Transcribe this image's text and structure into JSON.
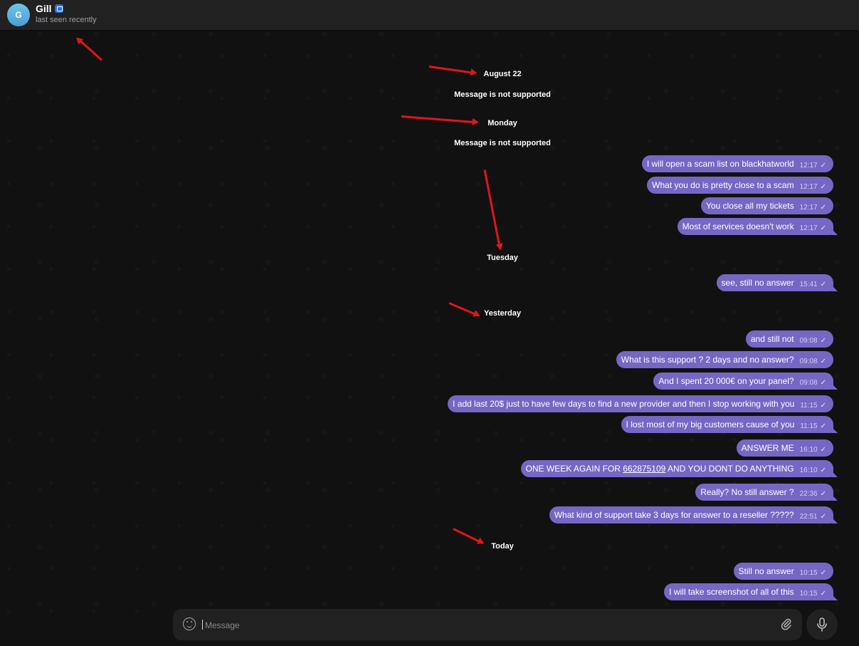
{
  "header": {
    "avatar_letter": "G",
    "name": "Gill",
    "status": "last seen recently"
  },
  "chat": {
    "dates": {
      "d1": "August 22",
      "d2": "Monday",
      "d3": "Tuesday",
      "d4": "Yesterday",
      "d5": "Today"
    },
    "service": {
      "s1": "Message is not supported",
      "s2": "Message is not supported"
    },
    "messages": [
      {
        "text": "I will open a scam list on blackhatworld",
        "time": "12:17"
      },
      {
        "text": "What you do is pretty close to a scam",
        "time": "12:17"
      },
      {
        "text": "You close all my tickets",
        "time": "12:17"
      },
      {
        "text": "Most of services doesn't work",
        "time": "12:17"
      },
      {
        "text": "see, still no answer",
        "time": "15:41"
      },
      {
        "text": "and still not",
        "time": "09:08"
      },
      {
        "text": "What is this support ? 2 days and no answer?",
        "time": "09:08"
      },
      {
        "text": "And I spent 20 000€ on your panel?",
        "time": "09:08"
      },
      {
        "text": "I add last 20$ just to have few days to find a new provider and then I stop working with you",
        "time": "11:15"
      },
      {
        "text": "I lost most of my big customers cause of you",
        "time": "11:15"
      },
      {
        "text": "ANSWER ME",
        "time": "16:10"
      },
      {
        "text_pre": "ONE WEEK AGAIN FOR ",
        "link": "662875109",
        "text_post": " AND YOU DONT DO ANYTHING",
        "time": "16:10"
      },
      {
        "text": "Really? No still answer ?",
        "time": "22:36"
      },
      {
        "text": "What kind of support take 3 days for answer to a reseller ?????",
        "time": "22:51"
      },
      {
        "text": "Still no answer",
        "time": "10:15"
      },
      {
        "text": "I will take screenshot of all of this",
        "time": "10:15"
      }
    ],
    "check_glyph": "✓"
  },
  "composer": {
    "placeholder": "Message",
    "emoji_icon": "emoji-icon",
    "attach_icon": "paperclip-icon",
    "mic_icon": "microphone-icon"
  },
  "colors": {
    "bubble": "#7667c5",
    "header": "#212121",
    "background": "#111112",
    "annotation_arrow": "#e0161b"
  }
}
